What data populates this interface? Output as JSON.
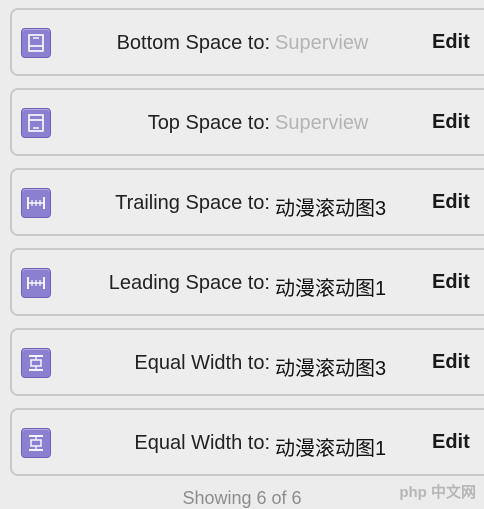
{
  "constraints": [
    {
      "icon": "bottom-space-icon",
      "label": "Bottom Space to:",
      "value": "Superview",
      "muted": true,
      "edit": "Edit"
    },
    {
      "icon": "top-space-icon",
      "label": "Top Space to:",
      "value": "Superview",
      "muted": true,
      "edit": "Edit"
    },
    {
      "icon": "trailing-space-icon",
      "label": "Trailing Space to:",
      "value": "动漫滚动图3",
      "muted": false,
      "edit": "Edit"
    },
    {
      "icon": "leading-space-icon",
      "label": "Leading Space to:",
      "value": "动漫滚动图1",
      "muted": false,
      "edit": "Edit"
    },
    {
      "icon": "equal-width-icon",
      "label": "Equal Width to:",
      "value": "动漫滚动图3",
      "muted": false,
      "edit": "Edit"
    },
    {
      "icon": "equal-width-icon",
      "label": "Equal Width to:",
      "value": "动漫滚动图1",
      "muted": false,
      "edit": "Edit"
    }
  ],
  "footer": "Showing 6 of 6",
  "watermark": "php 中文网",
  "colors": {
    "icon": "#8a7fd0",
    "muted": "#b4b4b4"
  }
}
